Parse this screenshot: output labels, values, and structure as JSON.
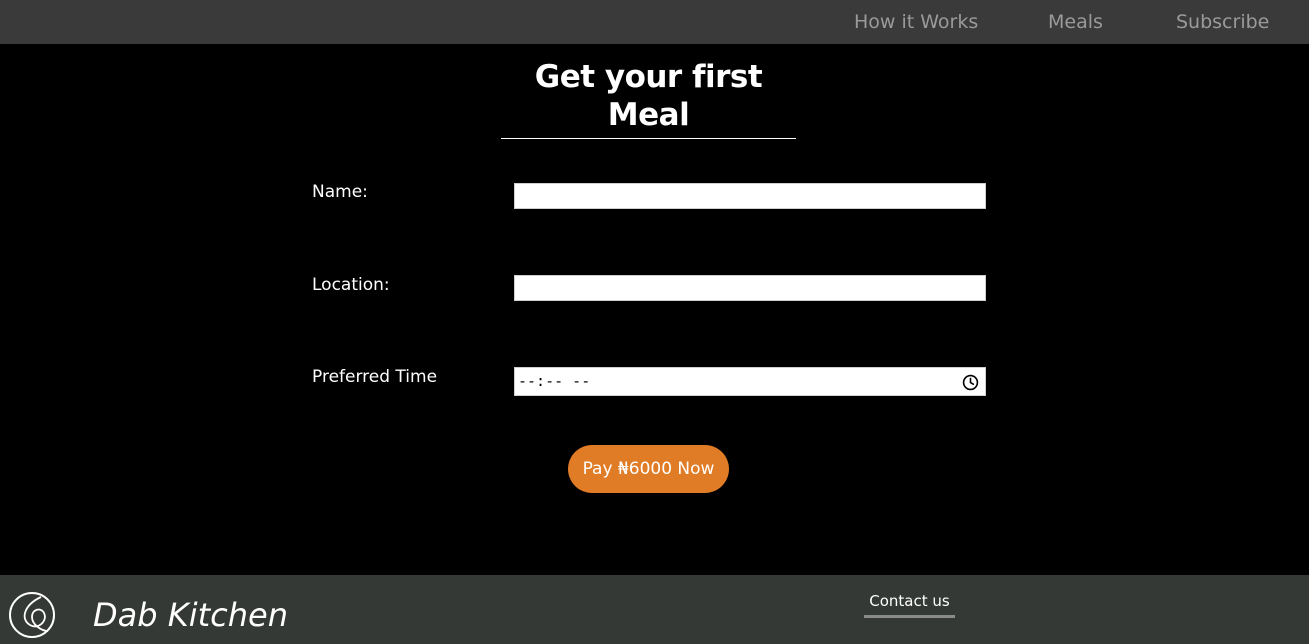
{
  "nav": {
    "items": [
      {
        "label": "How it Works"
      },
      {
        "label": "Meals"
      },
      {
        "label": "Subscribe"
      }
    ]
  },
  "form": {
    "heading": "Get your first Meal",
    "name_label": "Name:",
    "name_value": "",
    "location_label": "Location:",
    "location_value": "",
    "time_label": "Preferred Time",
    "time_value": "--:-- --",
    "pay_button": "Pay ₦6000 Now"
  },
  "footer": {
    "brand": "Dab Kitchen",
    "contact": "Contact us"
  },
  "colors": {
    "nav_bg": "#3a3a3a",
    "nav_text": "#9a9a9a",
    "page_bg": "#000000",
    "accent": "#e07b26",
    "footer_bg": "#353935"
  },
  "icons": {
    "clock": "clock-icon",
    "logo": "dab-kitchen-logo-icon"
  }
}
